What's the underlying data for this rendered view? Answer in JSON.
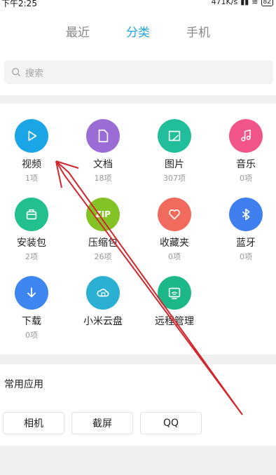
{
  "status": {
    "time": "下午2:25",
    "speed": "471K/s",
    "battery": "82"
  },
  "tabs": [
    {
      "label": "最近"
    },
    {
      "label": "分类"
    },
    {
      "label": "手机"
    }
  ],
  "active_tab": 1,
  "search": {
    "placeholder": "搜索"
  },
  "categories": [
    {
      "name": "视频",
      "count": "1项",
      "color": "#1aa5e6",
      "icon": "play-icon"
    },
    {
      "name": "文档",
      "count": "18项",
      "color": "#9b6bd6",
      "icon": "document-icon"
    },
    {
      "name": "图片",
      "count": "307项",
      "color": "#20bf9a",
      "icon": "image-icon"
    },
    {
      "name": "音乐",
      "count": "0项",
      "color": "#f2558a",
      "icon": "music-icon"
    },
    {
      "name": "安装包",
      "count": "2项",
      "color": "#21c08e",
      "icon": "package-icon"
    },
    {
      "name": "压缩包",
      "count": "26项",
      "color": "#84c326",
      "icon": "zip-icon"
    },
    {
      "name": "收藏夹",
      "count": "0项",
      "color": "#f06a5d",
      "icon": "heart-icon"
    },
    {
      "name": "蓝牙",
      "count": "0项",
      "color": "#3f7ff0",
      "icon": "bluetooth-icon"
    },
    {
      "name": "下载",
      "count": "0项",
      "color": "#3d86ef",
      "icon": "download-icon"
    },
    {
      "name": "小米云盘",
      "count": "",
      "color": "#2bb0d4",
      "icon": "cloud-icon"
    },
    {
      "name": "远程管理",
      "count": "",
      "color": "#1cb88a",
      "icon": "remote-icon"
    }
  ],
  "zip_label": "ZIP",
  "common": {
    "title": "常用应用",
    "apps": [
      "相机",
      "截屏",
      "QQ"
    ]
  }
}
